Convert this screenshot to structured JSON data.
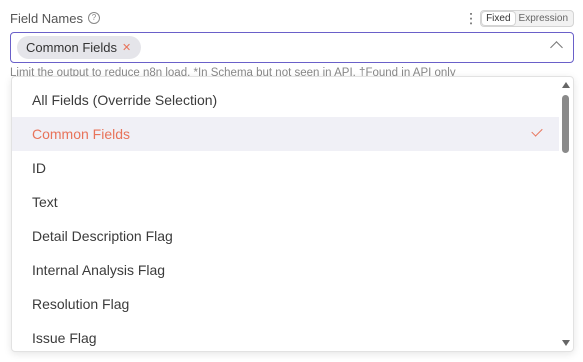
{
  "field": {
    "label": "Field Names",
    "help_icon": "question-circle-icon",
    "menu_icon": "kebab-menu-icon",
    "modes": [
      "Fixed",
      "Expression"
    ],
    "active_mode": "Fixed"
  },
  "select": {
    "chips": [
      {
        "label": "Common Fields",
        "remove_icon": "close-icon"
      }
    ],
    "toggle_icon": "chevron-up-icon"
  },
  "hint": "Limit the output to reduce n8n load. *In Schema but not seen in API. †Found in API only",
  "dropdown": {
    "options": [
      {
        "label": "All Fields (Override Selection)",
        "selected": false
      },
      {
        "label": "Common Fields",
        "selected": true
      },
      {
        "label": "ID",
        "selected": false
      },
      {
        "label": "Text",
        "selected": false
      },
      {
        "label": "Detail Description Flag",
        "selected": false
      },
      {
        "label": "Internal Analysis Flag",
        "selected": false
      },
      {
        "label": "Resolution Flag",
        "selected": false
      },
      {
        "label": "Issue Flag",
        "selected": false
      }
    ],
    "check_icon": "check-icon"
  },
  "colors": {
    "accent": "#e8735a",
    "focus_border": "#6a60c9",
    "selected_bg": "#f0f0f6"
  }
}
